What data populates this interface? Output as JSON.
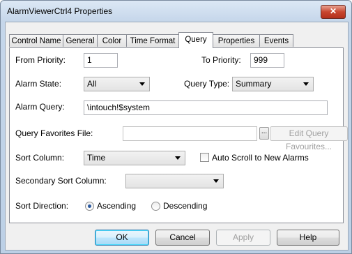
{
  "window": {
    "title": "AlarmViewerCtrl4 Properties",
    "close_glyph": "✕"
  },
  "tabs": [
    {
      "label": "Control Name"
    },
    {
      "label": "General"
    },
    {
      "label": "Color"
    },
    {
      "label": "Time Format"
    },
    {
      "label": "Query",
      "active": true
    },
    {
      "label": "Properties"
    },
    {
      "label": "Events"
    }
  ],
  "form": {
    "from_priority_label": "From Priority:",
    "from_priority_value": "1",
    "to_priority_label": "To Priority:",
    "to_priority_value": "999",
    "alarm_state_label": "Alarm State:",
    "alarm_state_value": "All",
    "query_type_label": "Query Type:",
    "query_type_value": "Summary",
    "alarm_query_label": "Alarm Query:",
    "alarm_query_value": "\\intouch!$system",
    "favorites_label": "Query Favorites File:",
    "favorites_value": "",
    "browse_label": "...",
    "edit_favorites_label": "Edit Query Favourites...",
    "sort_column_label": "Sort Column:",
    "sort_column_value": "Time",
    "auto_scroll_label": "Auto Scroll to New Alarms",
    "auto_scroll_checked": false,
    "secondary_sort_label": "Secondary Sort Column:",
    "secondary_sort_value": "",
    "sort_direction_label": "Sort Direction:",
    "ascending_label": "Ascending",
    "descending_label": "Descending",
    "selected_direction": "Ascending"
  },
  "buttons": {
    "ok": "OK",
    "cancel": "Cancel",
    "apply": "Apply",
    "help": "Help"
  }
}
